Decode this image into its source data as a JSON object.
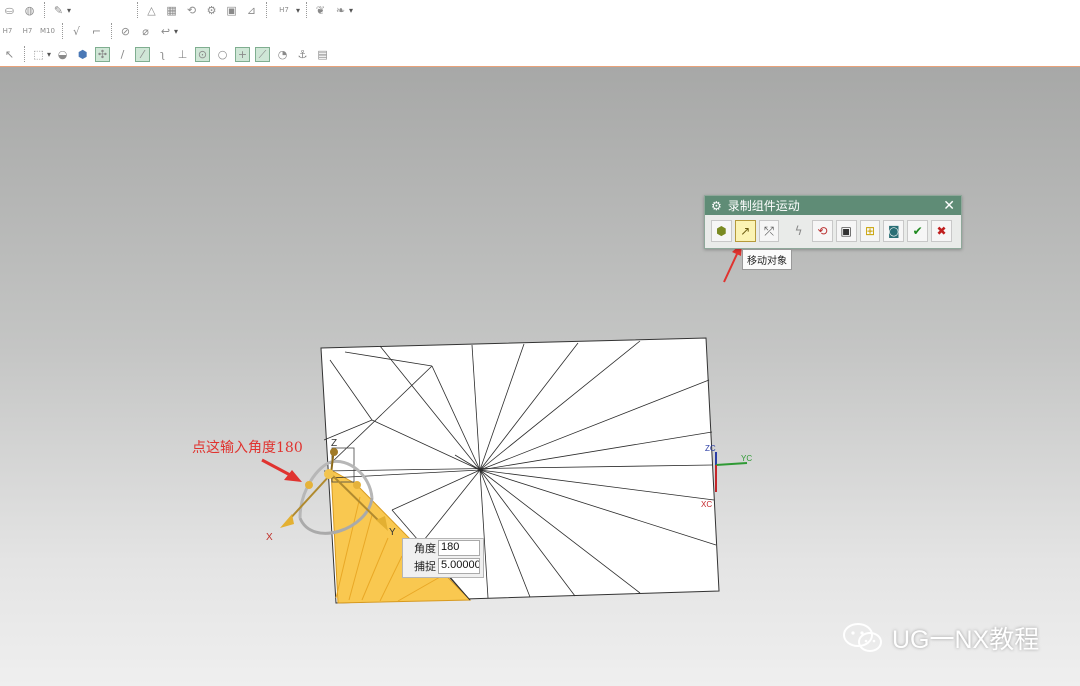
{
  "toolbar": {
    "row1_icons": [
      "paint-bucket-icon",
      "cylinder-icon",
      "bucket-icon",
      "triangle-icon",
      "grid-icon",
      "rotate-icon",
      "assembly-icon",
      "drawing-icon",
      "tolerance-icon",
      "weld-icon",
      "weld-2-icon"
    ],
    "row2_icons": [
      "hole-callout-icon",
      "tolerance-frame-icon",
      "datum-icon",
      "surface-finish-icon",
      "weld-symbol-icon",
      "circle-slash-icon",
      "no-symbol-icon",
      "arrow-icon"
    ],
    "row3_icons": [
      "pointer-icon",
      "select-box-icon",
      "view-icon",
      "cube-icon",
      "snap-point-icon",
      "line-icon",
      "draw-line-icon",
      "curve-icon",
      "arrow-up-icon",
      "circle-center-icon",
      "circle-icon",
      "plus-icon",
      "slash-icon",
      "arc-icon",
      "anchor-icon",
      "book-icon"
    ],
    "labels": {
      "hole_std": "H7",
      "tol_a": "H7",
      "tol_b": "H7",
      "tol_c": "M10"
    }
  },
  "dialog": {
    "title": "录制组件运动",
    "tool_icons": [
      "component-icon",
      "move-object-icon",
      "snap-icon",
      "lightning-icon",
      "rotate-xc-icon",
      "camera-pin-icon",
      "assembly-tree-icon",
      "camera-icon",
      "ok-icon",
      "cancel-icon"
    ],
    "tooltip": "移动对象"
  },
  "angle_input": {
    "angle_label": "角度",
    "angle_value": "180",
    "snap_label": "捕捉",
    "snap_value": "5.00000"
  },
  "annotation": "点这输入角度180",
  "axes": {
    "manip_z": "Z",
    "manip_x": "X",
    "manip_y": "Y",
    "wcs_zc": "ZC",
    "wcs_yc": "YC",
    "wcs_xc": "XC"
  },
  "watermark": "UG一NX教程",
  "colors": {
    "accent": "#e0332f",
    "dialog_header": "#5f8c76",
    "highlight_face": "#f9c850"
  }
}
